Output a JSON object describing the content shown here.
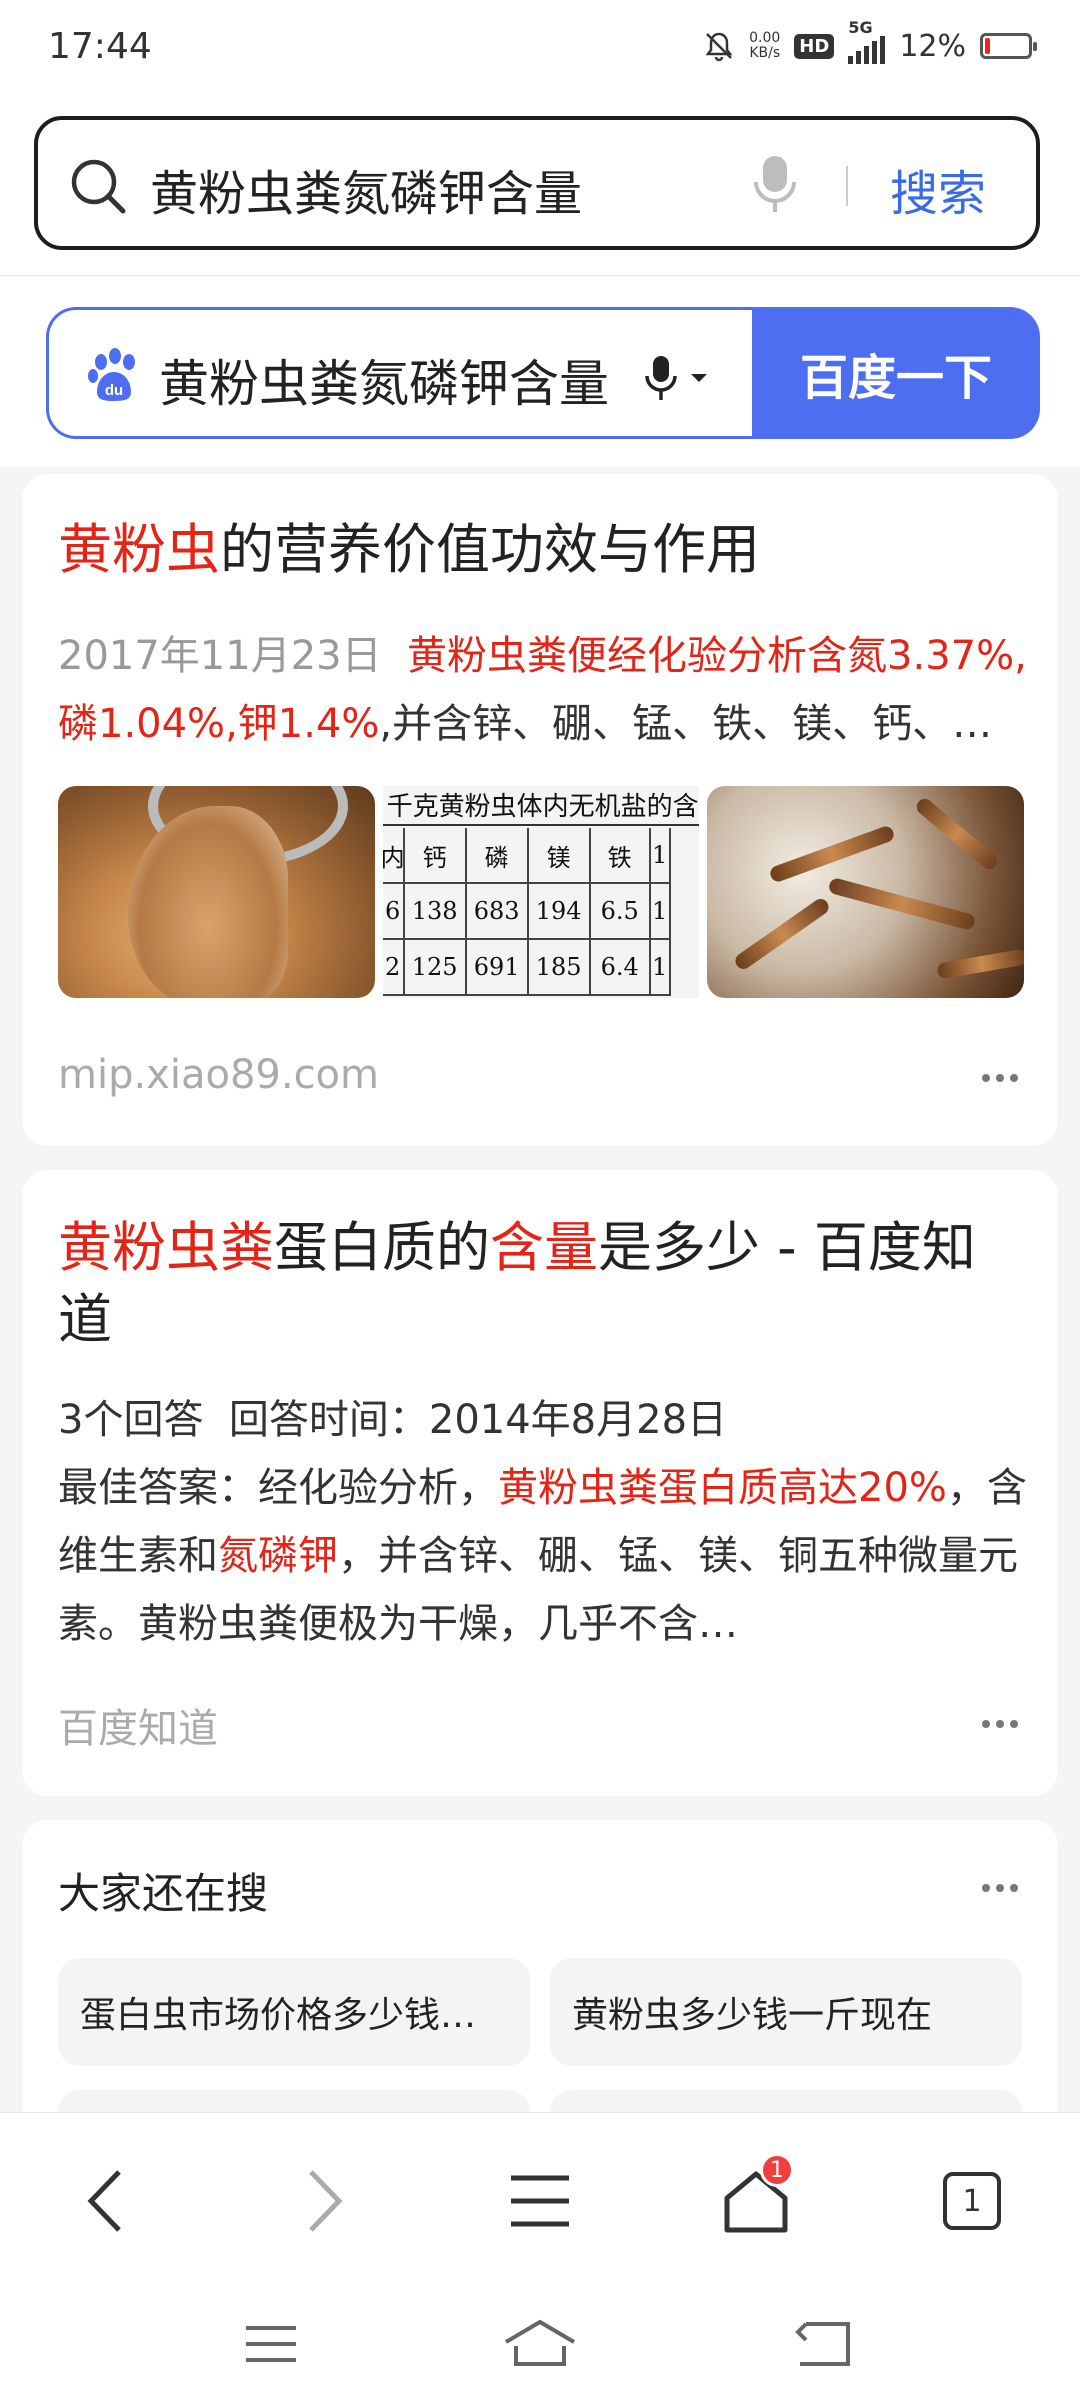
{
  "status_bar": {
    "time": "17:44",
    "speed_value": "0.00",
    "speed_unit": "KB/s",
    "hd": "HD",
    "network": "5G",
    "battery": "12%",
    "battery_level": 0.12,
    "icons": [
      "mute-bell-icon",
      "signal-icon",
      "battery-icon"
    ]
  },
  "top_search": {
    "query": "黄粉虫粪氮磷钾含量",
    "button": "搜索"
  },
  "baidu_search": {
    "query": "黄粉虫粪氮磷钾含量",
    "button": "百度一下",
    "brand_color": "#4e6ef2"
  },
  "results": [
    {
      "title_highlight": "黄粉虫",
      "title_rest": "的营养价值功效与作用",
      "date": "2017年11月23日",
      "snippet_highlight": "黄粉虫粪便经化验分析含氮3.37%,磷1.04%,钾1.4%",
      "snippet_rest": ",并含锌、硼、锰、铁、镁、钙、…",
      "image_table": {
        "header": "千克黄粉虫体内无机盐的含",
        "columns": [
          "内",
          "钙",
          "磷",
          "镁",
          "铁",
          "1"
        ],
        "rows": [
          [
            "6",
            "138",
            "683",
            "194",
            "6.5",
            "1"
          ],
          [
            "2",
            "125",
            "691",
            "185",
            "6.4",
            "1"
          ]
        ]
      },
      "source": "mip.xiao89.com"
    },
    {
      "title_part1": "黄粉虫粪",
      "title_part2": "蛋白质的",
      "title_part3": "含量",
      "title_part4": "是多少 - 百度知道",
      "meta_answers": "3个回答",
      "meta_time": "回答时间：2014年8月28日",
      "snippet_prefix": "最佳答案：经化验分析，",
      "snippet_red1": "黄粉虫粪蛋白质高达20%",
      "snippet_mid": "，含维生素和",
      "snippet_red2": "氮磷钾",
      "snippet_end": "，并含锌、硼、锰、镁、铜五种微量元素。黄粉虫粪便极为干燥，几乎不含…",
      "source": "百度知道"
    }
  ],
  "related": {
    "title": "大家还在搜",
    "items": [
      "蛋白虫市场价格多少钱…",
      "黄粉虫多少钱一斤现在"
    ]
  },
  "toolbar": {
    "home_badge": "1",
    "tabs_count": "1"
  },
  "accent_red": "#e32416"
}
